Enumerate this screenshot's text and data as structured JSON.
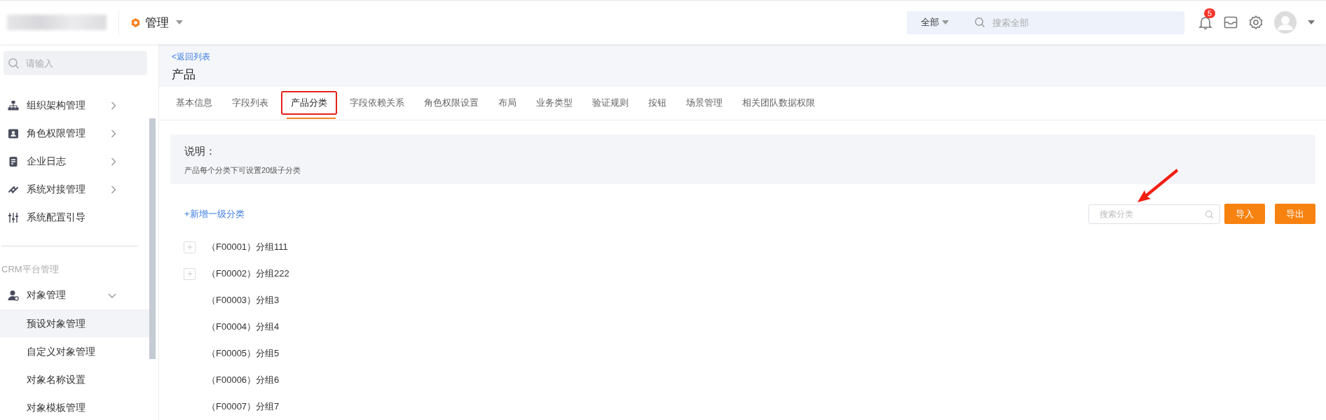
{
  "top_bar": {
    "module": "管理",
    "search_scope": "全部",
    "search_placeholder": "搜索全部",
    "notification_count": "5"
  },
  "sidebar": {
    "search_placeholder": "请输入",
    "items": [
      {
        "label": "组织架构管理",
        "expanded": false
      },
      {
        "label": "角色权限管理",
        "expanded": false
      },
      {
        "label": "企业日志",
        "expanded": false
      },
      {
        "label": "系统对接管理",
        "expanded": false
      },
      {
        "label": "系统配置引导"
      }
    ],
    "section_title": "CRM平台管理",
    "section_items": [
      {
        "label": "对象管理",
        "expanded": true,
        "children": [
          {
            "label": "预设对象管理",
            "selected": true
          },
          {
            "label": "自定义对象管理",
            "selected": false
          },
          {
            "label": "对象名称设置",
            "selected": false
          },
          {
            "label": "对象模板管理",
            "selected": false
          }
        ]
      }
    ]
  },
  "page": {
    "back_link": "<返回列表",
    "title": "产品",
    "tabs": [
      {
        "label": "基本信息",
        "selected": false
      },
      {
        "label": "字段列表",
        "selected": false
      },
      {
        "label": "产品分类",
        "selected": true
      },
      {
        "label": "字段依赖关系",
        "selected": false
      },
      {
        "label": "角色权限设置",
        "selected": false
      },
      {
        "label": "布局",
        "selected": false
      },
      {
        "label": "业务类型",
        "selected": false
      },
      {
        "label": "验证规则",
        "selected": false
      },
      {
        "label": "按钮",
        "selected": false
      },
      {
        "label": "场景管理",
        "selected": false
      },
      {
        "label": "相关团队数据权限",
        "selected": false
      }
    ],
    "note": {
      "title": "说明：",
      "text": "产品每个分类下可设置20级子分类"
    },
    "add_link": "+新增一级分类",
    "category_search_placeholder": "搜索分类",
    "buttons": [
      "导入",
      "导出"
    ],
    "categories": [
      {
        "label": "（F00001）分组111",
        "has_children": true
      },
      {
        "label": "（F00002）分组222",
        "has_children": true
      },
      {
        "label": "（F00003）分组3",
        "has_children": false
      },
      {
        "label": "（F00004）分组4",
        "has_children": false
      },
      {
        "label": "（F00005）分组5",
        "has_children": false
      },
      {
        "label": "（F00006）分组6",
        "has_children": false
      },
      {
        "label": "（F00007）分组7",
        "has_children": false
      }
    ]
  }
}
